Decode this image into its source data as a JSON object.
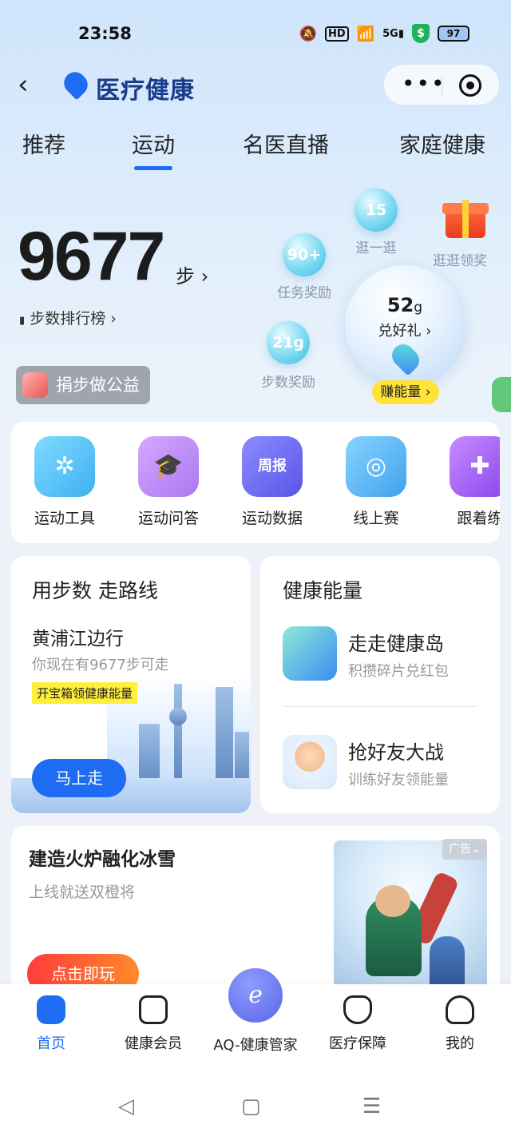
{
  "status": {
    "time": "23:58",
    "battery": "97"
  },
  "header": {
    "app_title": "医疗健康"
  },
  "tabs": [
    {
      "label": "推荐"
    },
    {
      "label": "运动"
    },
    {
      "label": "名医直播"
    },
    {
      "label": "家庭健康"
    }
  ],
  "steps": {
    "count": "9677",
    "unit": "步",
    "rank_label": "步数排行榜",
    "donate_label": "捐步做公益"
  },
  "rewards": {
    "stroll": {
      "value": "15",
      "label": "逛一逛"
    },
    "task": {
      "value": "90+",
      "label": "任务奖励"
    },
    "step": {
      "value": "21g",
      "label": "步数奖励"
    },
    "gift_label": "逛逛领奖",
    "energy_amount": "52",
    "energy_unit": "g",
    "exchange_label": "兑好礼",
    "earn_label": "赚能量"
  },
  "tools": [
    {
      "label": "运动工具",
      "icon": "running-person-icon",
      "color": "#4fc3f7"
    },
    {
      "label": "运动问答",
      "icon": "graduation-cap-icon",
      "color": "#b889f5"
    },
    {
      "label": "运动数据",
      "icon": "weekly-report-icon",
      "glyph": "周报",
      "color": "#6e6cf0"
    },
    {
      "label": "线上赛",
      "icon": "medal-icon",
      "color": "#54b7f2"
    },
    {
      "label": "跟着练",
      "icon": "exercise-person-icon",
      "color": "#a55ff0"
    }
  ],
  "route_card": {
    "title": "用步数 走路线",
    "place": "黄浦江边行",
    "subtitle": "你现在有9677步可走",
    "tag": "开宝箱领健康能量",
    "go_label": "马上走"
  },
  "energy_card": {
    "title": "健康能量",
    "items": [
      {
        "name": "走走健康岛",
        "desc": "积攒碎片兑红包"
      },
      {
        "name": "抢好友大战",
        "desc": "训练好友领能量"
      }
    ]
  },
  "ad": {
    "title": "建造火炉融化冰雪",
    "subtitle": "上线就送双橙将",
    "play_label": "点击即玩",
    "ad_tag": "广告"
  },
  "bottom_nav": [
    {
      "label": "首页",
      "icon": "home-icon"
    },
    {
      "label": "健康会员",
      "icon": "member-icon"
    },
    {
      "label": "AQ-健康管家",
      "icon": "aq-assistant-icon"
    },
    {
      "label": "医疗保障",
      "icon": "medical-plus-icon"
    },
    {
      "label": "我的",
      "icon": "profile-icon"
    }
  ]
}
